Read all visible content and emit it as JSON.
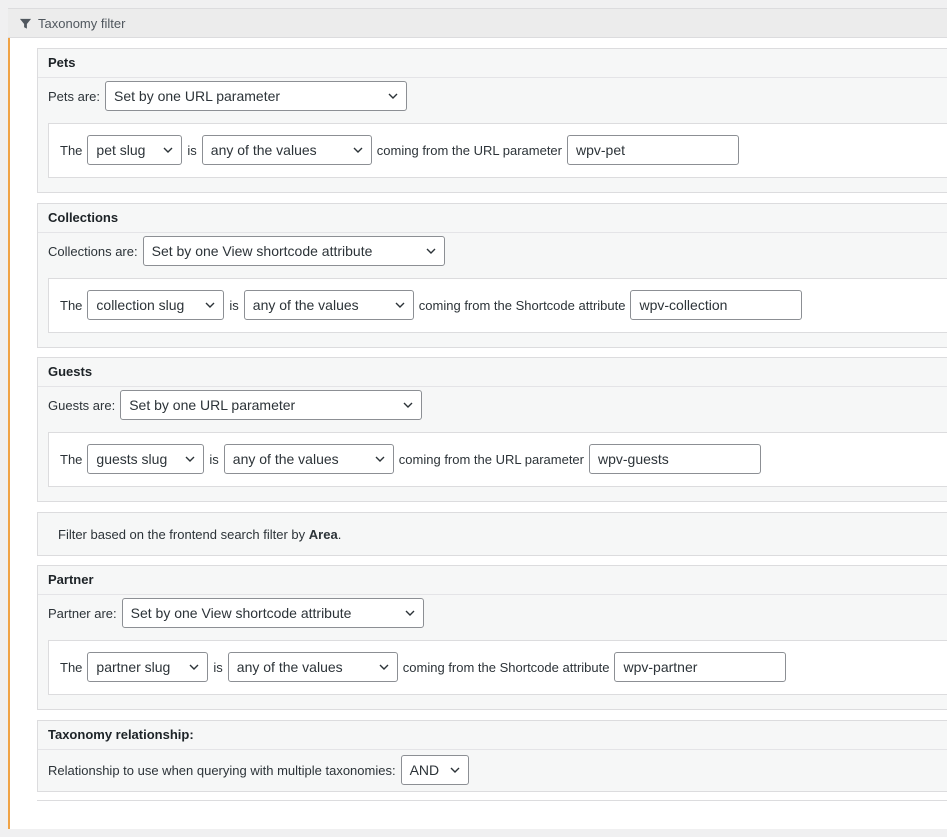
{
  "header": {
    "title": "Taxonomy filter",
    "icon": "filter-funnel"
  },
  "sections": [
    {
      "title": "Pets",
      "mode_label": "Pets are:",
      "mode_value": "Set by one URL parameter",
      "the_label": "The",
      "slug_value": "pet slug",
      "is_label": "is",
      "op_value": "any of the values",
      "coming_label": "coming from the URL parameter",
      "param_value": "wpv-pet"
    },
    {
      "title": "Collections",
      "mode_label": "Collections are:",
      "mode_value": "Set by one View shortcode attribute",
      "the_label": "The",
      "slug_value": "collection slug",
      "is_label": "is",
      "op_value": "any of the values",
      "coming_label": "coming from the Shortcode attribute",
      "param_value": "wpv-collection"
    },
    {
      "title": "Guests",
      "mode_label": "Guests are:",
      "mode_value": "Set by one URL parameter",
      "the_label": "The",
      "slug_value": "guests slug",
      "is_label": "is",
      "op_value": "any of the values",
      "coming_label": "coming from the URL parameter",
      "param_value": "wpv-guests"
    },
    {
      "title": "Partner",
      "mode_label": "Partner are:",
      "mode_value": "Set by one View shortcode attribute",
      "the_label": "The",
      "slug_value": "partner slug",
      "is_label": "is",
      "op_value": "any of the values",
      "coming_label": "coming from the Shortcode attribute",
      "param_value": "wpv-partner"
    }
  ],
  "note": {
    "prefix": "Filter based on the frontend search filter by",
    "field": "Area",
    "suffix": "."
  },
  "relationship": {
    "title": "Taxonomy relationship:",
    "label": "Relationship to use when querying with multiple taxonomies:",
    "value": "AND"
  },
  "colors": {
    "accent": "#f0a346",
    "panel_bg": "#f6f7f7",
    "border": "#dcdcde",
    "text": "#1d2327"
  }
}
